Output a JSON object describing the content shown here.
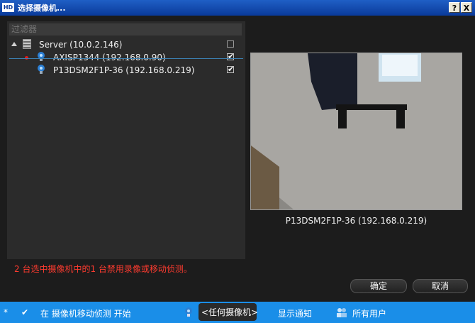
{
  "window": {
    "logo": "HD",
    "title": "选择摄像机...",
    "help_btn": "?",
    "close_btn": "X"
  },
  "filter": {
    "placeholder": "过滤器"
  },
  "tree": {
    "server": {
      "label": "Server (10.0.2.146)"
    },
    "cameras": [
      {
        "label": "AXISP1344 (192.168.0.90)",
        "check": "✔",
        "recording": true
      },
      {
        "label": "P13DSM2F1P-36 (192.168.0.219)",
        "check": "✔",
        "recording": false
      }
    ]
  },
  "preview": {
    "caption": "P13DSM2F1P-36 (192.168.0.219)"
  },
  "warning": "2 台选中摄像机中的1 台禁用录像或移动侦测。",
  "buttons": {
    "ok": "确定",
    "cancel": "取消"
  },
  "statusbar": {
    "star": "*",
    "check": "✔",
    "event_text": "在 摄像机移动侦测 开始",
    "camera_selector": "<任何摄像机>",
    "notify": "显示通知",
    "users": "所有用户"
  },
  "colors": {
    "accent": "#1a8ee8",
    "warning": "#ff3b2f",
    "recording": "#e21b1b"
  }
}
